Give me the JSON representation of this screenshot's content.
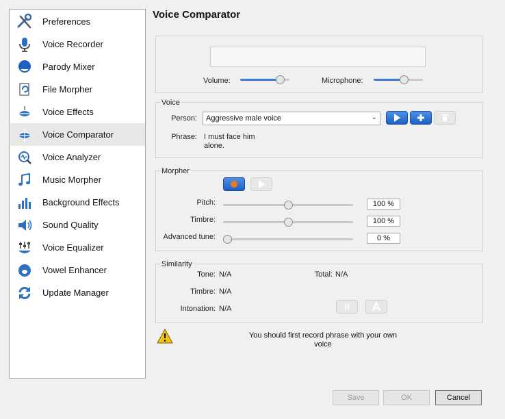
{
  "sidebar": {
    "items": [
      {
        "label": "Preferences",
        "icon": "tools-icon"
      },
      {
        "label": "Voice Recorder",
        "icon": "microphone-icon"
      },
      {
        "label": "Parody Mixer",
        "icon": "face-icon"
      },
      {
        "label": "File Morpher",
        "icon": "file-morph-icon"
      },
      {
        "label": "Voice Effects",
        "icon": "lips-effects-icon"
      },
      {
        "label": "Voice Comparator",
        "icon": "lips-compare-icon",
        "selected": true
      },
      {
        "label": "Voice Analyzer",
        "icon": "analyzer-icon"
      },
      {
        "label": "Music Morpher",
        "icon": "music-note-icon"
      },
      {
        "label": "Background Effects",
        "icon": "background-bars-icon"
      },
      {
        "label": "Sound Quality",
        "icon": "speaker-icon"
      },
      {
        "label": "Voice Equalizer",
        "icon": "equalizer-icon"
      },
      {
        "label": "Vowel Enhancer",
        "icon": "vowel-icon"
      },
      {
        "label": "Update Manager",
        "icon": "update-arrows-icon"
      }
    ]
  },
  "main": {
    "title": "Voice Comparator",
    "volume_label": "Volume:",
    "volume_level": 0.88,
    "microphone_label": "Microphone:",
    "microphone_level": 0.65
  },
  "voice": {
    "group_label": "Voice",
    "person_label": "Person:",
    "person_value": "Aggressive male voice",
    "phrase_label": "Phrase:",
    "phrase_line1": "I must face him",
    "phrase_line2": "alone."
  },
  "morpher": {
    "group_label": "Morpher",
    "pitch_label": "Pitch:",
    "pitch_value": "100 %",
    "pitch_level": 0.5,
    "timbre_label": "Timbre:",
    "timbre_value": "100 %",
    "timbre_level": 0.5,
    "advanced_label": "Advanced tune:",
    "advanced_value": "0 %",
    "advanced_level": 0.0
  },
  "similarity": {
    "group_label": "Similarity",
    "tone_label": "Tone:",
    "tone_value": "N/A",
    "total_label": "Total:",
    "total_value": "N/A",
    "timbre_label": "Timbre:",
    "timbre_value": "N/A",
    "intonation_label": "Intonation:",
    "intonation_value": "N/A"
  },
  "message": {
    "line1": "You should first record phrase with your own",
    "line2": "voice"
  },
  "buttons": {
    "save": "Save",
    "ok": "OK",
    "cancel": "Cancel"
  },
  "colors": {
    "accent_blue": "#3a7bd5",
    "record_orange": "#f07a1a",
    "selected_bg": "#e8e8e8"
  }
}
